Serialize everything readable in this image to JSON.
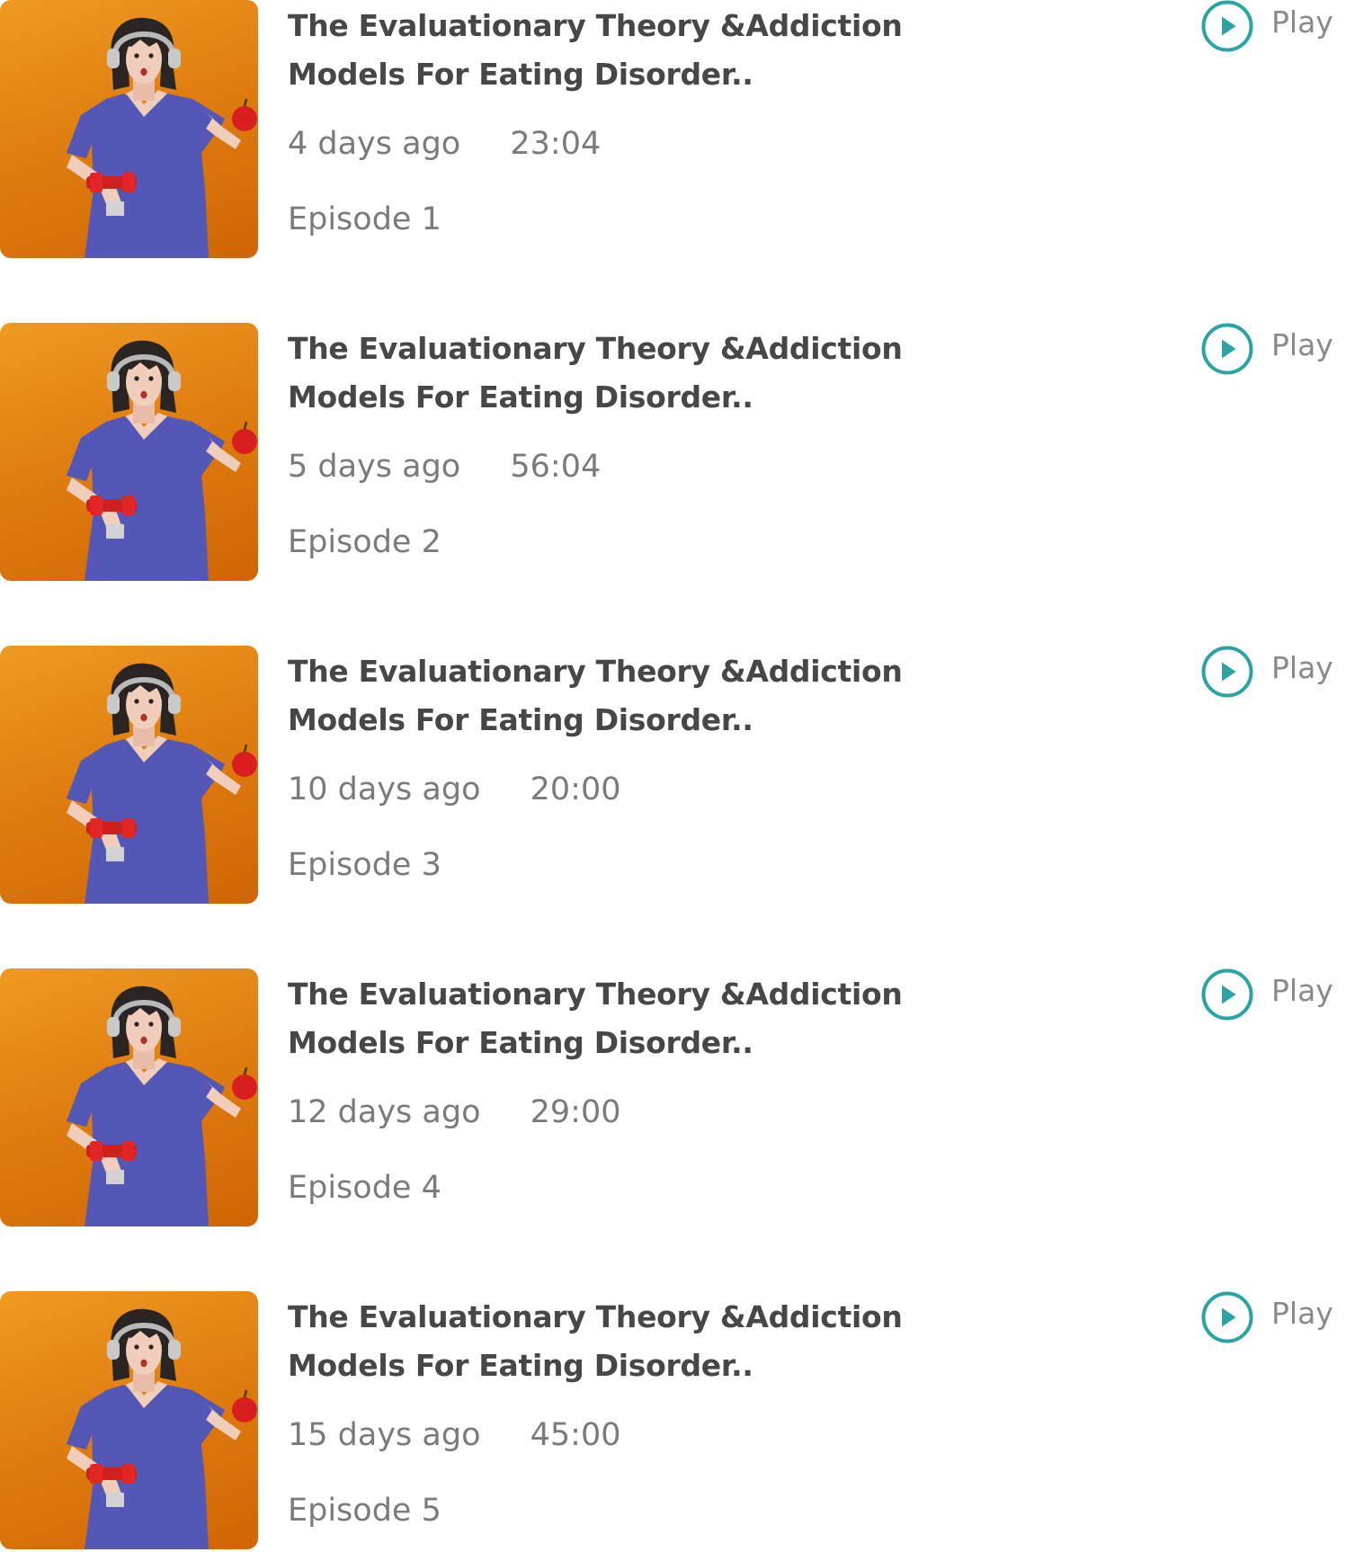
{
  "accent_color": "#2aa3a3",
  "thumbnail_background": "#e5860f",
  "episodes": [
    {
      "title": "The Evaluationary Theory &Addiction Models For Eating Disorder..",
      "date": "4 days ago",
      "duration": "23:04",
      "episode_label": "Episode 1",
      "play_label": "Play",
      "icon": "play-circle-icon"
    },
    {
      "title": "The Evaluationary Theory &Addiction Models For Eating Disorder..",
      "date": "5 days ago",
      "duration": "56:04",
      "episode_label": "Episode 2",
      "play_label": "Play",
      "icon": "play-circle-icon"
    },
    {
      "title": "The Evaluationary Theory &Addiction Models For Eating Disorder..",
      "date": "10 days ago",
      "duration": "20:00",
      "episode_label": "Episode 3",
      "play_label": "Play",
      "icon": "play-circle-icon"
    },
    {
      "title": "The Evaluationary Theory &Addiction Models For Eating Disorder..",
      "date": "12 days ago",
      "duration": "29:00",
      "episode_label": "Episode 4",
      "play_label": "Play",
      "icon": "play-circle-icon"
    },
    {
      "title": "The Evaluationary Theory &Addiction Models For Eating Disorder..",
      "date": "15 days ago",
      "duration": "45:00",
      "episode_label": "Episode 5",
      "play_label": "Play",
      "icon": "play-circle-icon"
    }
  ]
}
